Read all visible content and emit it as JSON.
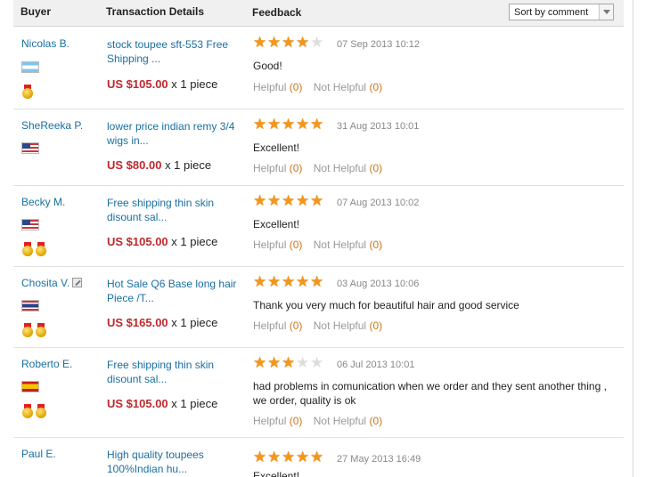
{
  "header": {
    "buyer": "Buyer",
    "transaction": "Transaction Details",
    "feedback": "Feedback",
    "sort": "Sort by comment"
  },
  "labels": {
    "helpful": "Helpful",
    "not_helpful": "Not Helpful",
    "open": "(",
    "close": ")"
  },
  "reviews": [
    {
      "buyer": "Nicolas B.",
      "flag": "argentina-flag",
      "medals": 1,
      "title": "stock toupee sft-553 Free Shipping ...",
      "price": "US $105.00",
      "qty": "x 1 piece",
      "stars": 4,
      "date": "07 Sep 2013 10:12",
      "comment": "Good!",
      "helpful": "0",
      "not_helpful": "0"
    },
    {
      "buyer": "SheReeka P.",
      "flag": "us-flag",
      "medals": 0,
      "title": "lower price indian remy 3/4 wigs in...",
      "price": "US $80.00",
      "qty": "x 1 piece",
      "stars": 5,
      "date": "31 Aug 2013 10:01",
      "comment": "Excellent!",
      "helpful": "0",
      "not_helpful": "0"
    },
    {
      "buyer": "Becky M.",
      "flag": "us-flag",
      "medals": 2,
      "title": "Free shipping thin skin disount sal...",
      "price": "US $105.00",
      "qty": "x 1 piece",
      "stars": 5,
      "date": "07 Aug 2013 10:02",
      "comment": "Excellent!",
      "helpful": "0",
      "not_helpful": "0"
    },
    {
      "buyer": "Chosita V.",
      "flag": "thailand-flag",
      "medals": 2,
      "title": "Hot Sale Q6 Base long hair Piece /T...",
      "price": "US $165.00",
      "qty": "x 1 piece",
      "stars": 5,
      "date": "03 Aug 2013 10:06",
      "comment": "Thank you very much for beautiful hair and good service",
      "helpful": "0",
      "not_helpful": "0"
    },
    {
      "buyer": "Roberto E.",
      "flag": "spain-flag",
      "medals": 2,
      "title": "Free shipping thin skin disount sal...",
      "price": "US $105.00",
      "qty": "x 1 piece",
      "stars": 3,
      "date": "06 Jul 2013 10:01",
      "comment": "had problems in comunication when we order and they sent another thing , we order, quality is ok",
      "helpful": "0",
      "not_helpful": "0"
    },
    {
      "buyer": "Paul E.",
      "flag": "",
      "medals": 0,
      "title": "High quality toupees 100%Indian hu...",
      "price": "",
      "qty": "",
      "stars": 5,
      "date": "27 May 2013 16:49",
      "comment": "Excellent!",
      "helpful": "",
      "not_helpful": ""
    }
  ]
}
